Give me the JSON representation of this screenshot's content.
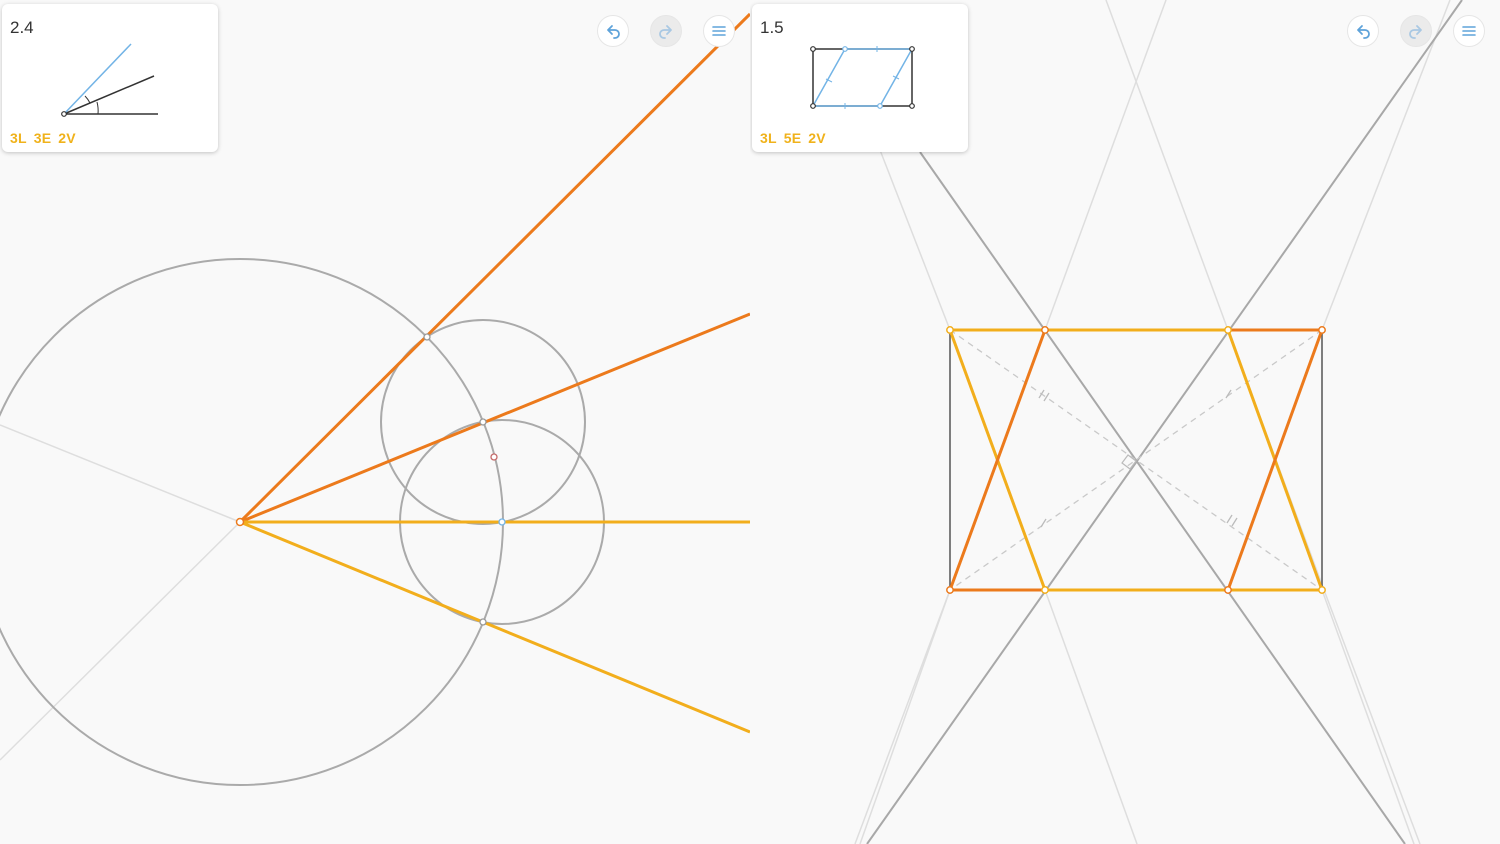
{
  "left_panel": {
    "level": "2.4",
    "stats": {
      "lines": "3L",
      "euclid_moves": "3E",
      "verified": "2V"
    }
  },
  "right_panel": {
    "level": "1.5",
    "stats": {
      "lines": "3L",
      "euclid_moves": "5E",
      "verified": "2V"
    }
  },
  "toolbar": {
    "undo_icon": "undo-arrow-icon",
    "redo_icon": "redo-arrow-icon",
    "menu_icon": "hamburger-menu-icon"
  },
  "colors": {
    "orange": "#ec7a1c",
    "yellow": "#f2ae1c",
    "gray_line": "#aaaaaa",
    "light_line": "#dedede",
    "hint_blue": "#73b4e6",
    "stats_yellow": "#f0b21b"
  }
}
